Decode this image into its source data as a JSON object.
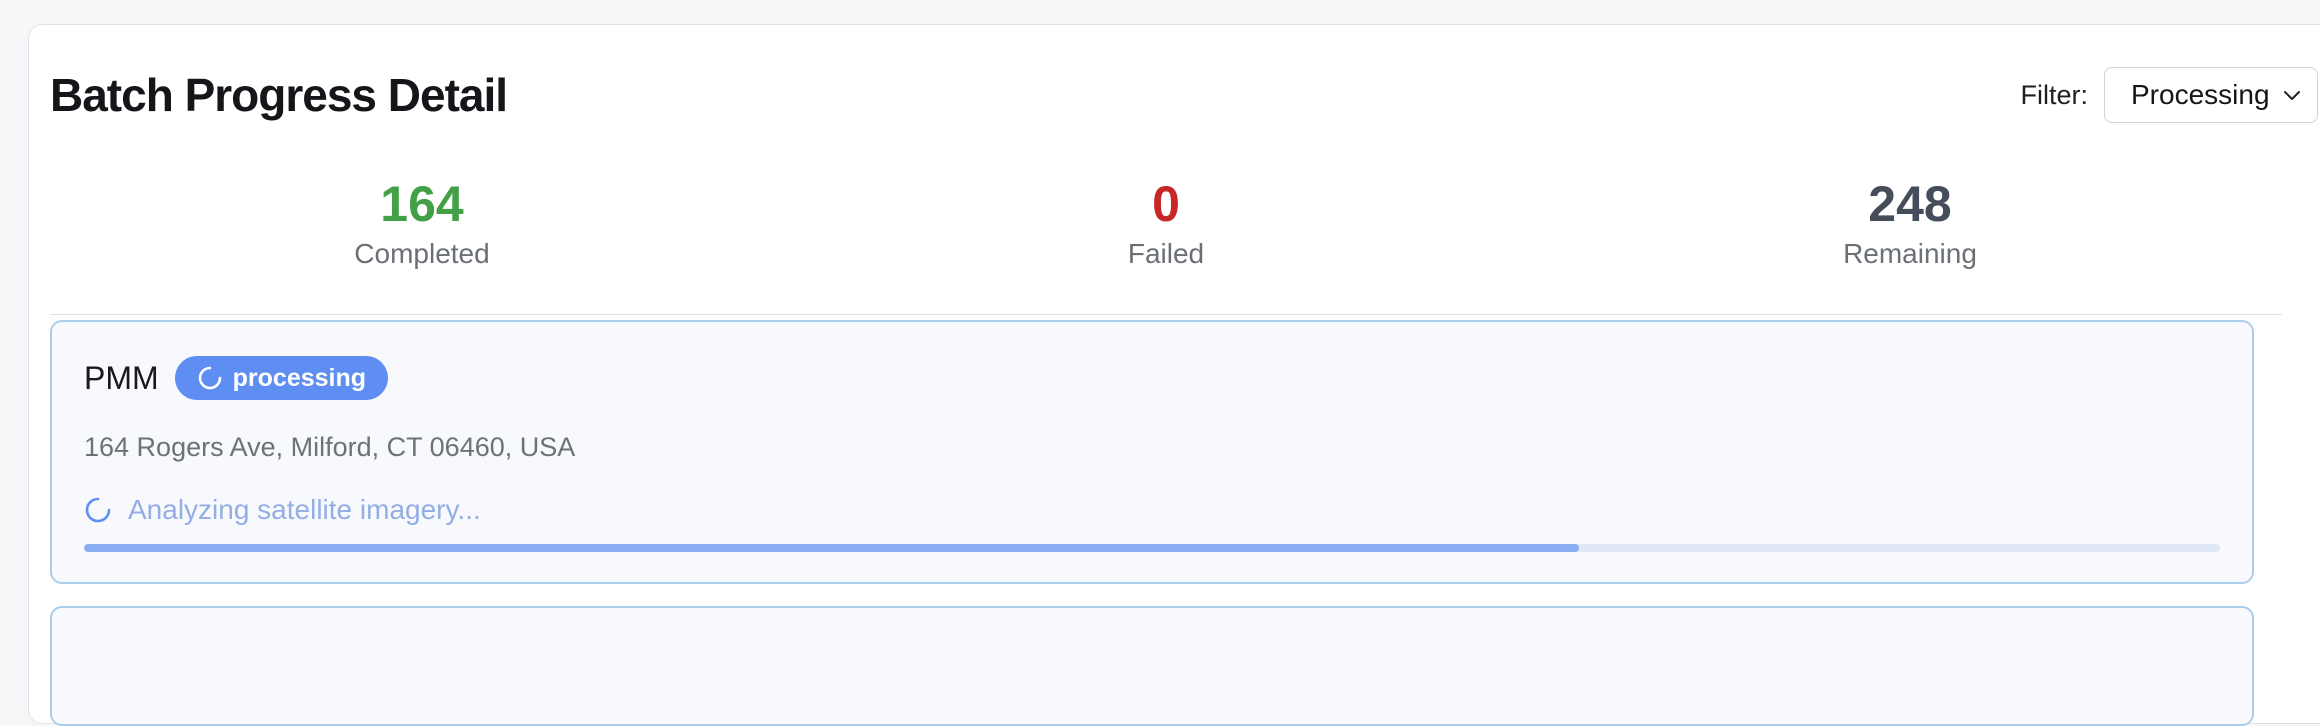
{
  "page": {
    "title": "Batch Progress Detail"
  },
  "filter": {
    "label": "Filter:",
    "selected": "Processing"
  },
  "stats": [
    {
      "value": "164",
      "label": "Completed",
      "color": "#43a047"
    },
    {
      "value": "0",
      "label": "Failed",
      "color": "#c62828"
    },
    {
      "value": "248",
      "label": "Remaining",
      "color": "#454c5a"
    }
  ],
  "jobs": [
    {
      "name": "PMM",
      "badge": "processing",
      "address": "164 Rogers Ave, Milford, CT 06460, USA",
      "status_text": "Analyzing satellite imagery...",
      "progress": 0.7
    }
  ],
  "icons": {
    "badge_icon": "spinner-icon",
    "status_icon": "spinner-icon",
    "select_icon": "chevron-down-icon"
  },
  "colors": {
    "accent": "#5f8ef3",
    "progress": "#89adf0",
    "card_border": "#a9cdea"
  }
}
